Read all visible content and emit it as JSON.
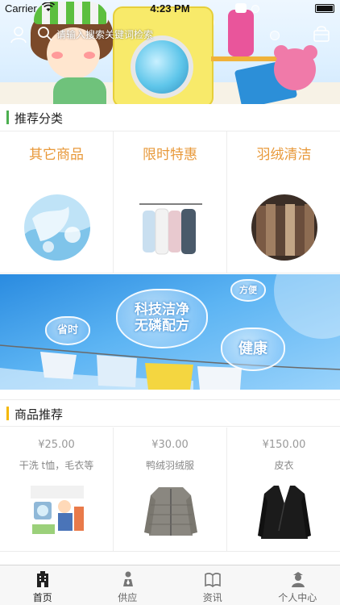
{
  "status_bar": {
    "carrier": "Carrier",
    "time": "4:23 PM"
  },
  "header": {
    "search_placeholder": "请输入搜索关键词检索"
  },
  "categories": {
    "title": "推荐分类",
    "accent": "#4caf50",
    "items": [
      {
        "label": "其它商品"
      },
      {
        "label": "限时特惠"
      },
      {
        "label": "羽绒清洁"
      }
    ]
  },
  "promo": {
    "hearts": [
      "科技洁净\n无磷配方",
      "方便",
      "省时",
      "健康"
    ]
  },
  "products": {
    "title": "商品推荐",
    "accent": "#f5b800",
    "items": [
      {
        "price": "¥25.00",
        "name": "干洗  t恤，毛衣等"
      },
      {
        "price": "¥30.00",
        "name": "鸭绒羽绒服"
      },
      {
        "price": "¥150.00",
        "name": "皮衣"
      }
    ]
  },
  "tabbar": {
    "items": [
      {
        "label": "首页",
        "icon": "building-icon",
        "active": true
      },
      {
        "label": "供应",
        "icon": "supply-person-icon",
        "active": false
      },
      {
        "label": "资讯",
        "icon": "open-book-icon",
        "active": false
      },
      {
        "label": "个人中心",
        "icon": "profile-icon",
        "active": false
      }
    ]
  }
}
